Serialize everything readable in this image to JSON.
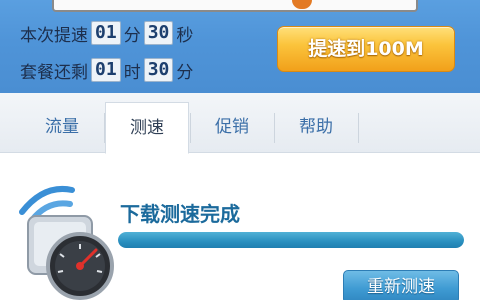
{
  "speed_info": {
    "this_speedup_label": "本次提速",
    "this_speedup_minutes": "01",
    "minute_unit": "分",
    "this_speedup_seconds": "30",
    "second_unit": "秒",
    "package_remaining_label": "套餐还剩",
    "package_remaining_hours": "01",
    "hour_unit": "时",
    "package_remaining_minutes": "30",
    "minute_unit_2": "分"
  },
  "speedup_button": {
    "label": "提速到100M"
  },
  "tabs": [
    {
      "label": "流量",
      "active": false
    },
    {
      "label": "测速",
      "active": true
    },
    {
      "label": "促销",
      "active": false
    },
    {
      "label": "帮助",
      "active": false
    }
  ],
  "speed_test": {
    "status_title": "下载测速完成",
    "progress": 1.0,
    "retest_label": "重新测速"
  },
  "colors": {
    "panel_blue": "#4f94d8",
    "accent_orange": "#f1a01a",
    "progress_blue": "#2a8fbf",
    "title_blue": "#1b6a9c"
  },
  "icons": {
    "speedometer": "speedometer-wifi-icon",
    "meter_needle": "meter-needle-icon"
  }
}
